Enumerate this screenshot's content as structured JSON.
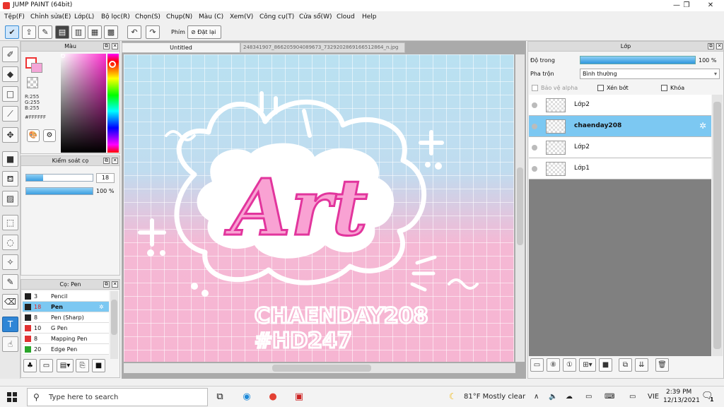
{
  "window": {
    "title": "JUMP PAINT (64bit)"
  },
  "menu": [
    "Tệp(F)",
    "Chỉnh sửa(E)",
    "Lớp(L)",
    "Bộ lọc(R)",
    "Chọn(S)",
    "Chụp(N)",
    "Màu (C)",
    "Xem(V)",
    "Công cụ(T)",
    "Cửa sổ(W)",
    "Cloud",
    "Help"
  ],
  "toolbar": {
    "phim_label": "Phím",
    "reset_label": "Đặt lại"
  },
  "color_panel": {
    "title": "Màu",
    "r": "R:255",
    "g": "G:255",
    "b": "B:255",
    "hex": "#FFFFFF"
  },
  "brush_control": {
    "title": "Kiểm soát cọ",
    "size": "18",
    "opacity": "100 %",
    "size_fraction": 0.25,
    "opacity_fraction": 1.0
  },
  "pen_panel": {
    "title": "Cọ: Pen",
    "pens": [
      {
        "size": "3",
        "name": "Pencil",
        "color": "#222222"
      },
      {
        "size": "18",
        "name": "Pen",
        "color": "#222222",
        "selected": true
      },
      {
        "size": "8",
        "name": "Pen (Sharp)",
        "color": "#222222"
      },
      {
        "size": "10",
        "name": "G Pen",
        "color": "#e03030"
      },
      {
        "size": "8",
        "name": "Mapping Pen",
        "color": "#e03030"
      },
      {
        "size": "20",
        "name": "Edge Pen",
        "color": "#2aa52a"
      }
    ]
  },
  "canvas": {
    "tab_title": "Untitled",
    "tab2_title": "248341907_866205904089673_7329202869166512864_n.jpg",
    "art_word": "Art",
    "art_line1": "CHAENDAY208",
    "art_line2": "#HD247"
  },
  "layer_panel": {
    "title": "Lớp",
    "opacity_label": "Độ trong",
    "opacity_value": "100 %",
    "blend_label": "Pha trộn",
    "blend_value": "Bình thường",
    "protect_alpha": "Bảo vệ alpha",
    "clip": "Xén bớt",
    "lock": "Khóa",
    "layers": [
      {
        "name": "Lớp2",
        "selected": false
      },
      {
        "name": "chaenday208",
        "selected": true
      },
      {
        "name": "Lớp2",
        "selected": false
      },
      {
        "name": "Lớp1",
        "selected": false
      }
    ]
  },
  "taskbar": {
    "search_placeholder": "Type here to search",
    "weather": "81°F  Mostly clear",
    "lang": "VIE",
    "time": "2:39 PM",
    "date": "12/13/2021",
    "notif_count": "1"
  },
  "colors": {
    "accent": "#7cc8f2",
    "canvas_pink": "#f6b5d2",
    "canvas_blue": "#b9e1f1",
    "art_pink": "#f35fb7"
  }
}
